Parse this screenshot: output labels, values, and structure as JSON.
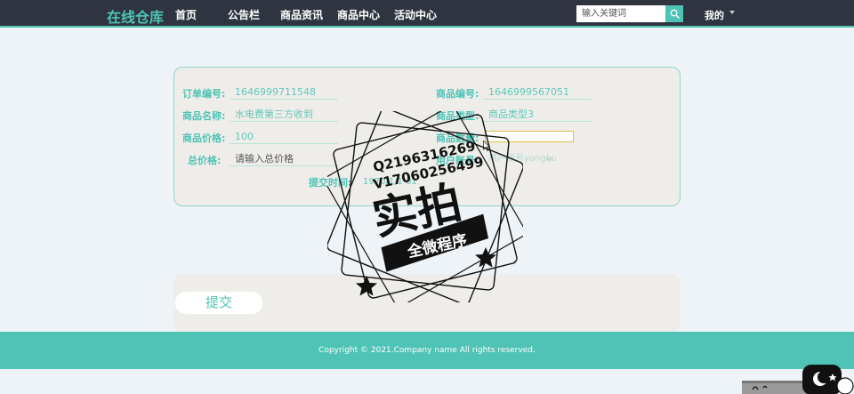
{
  "nav": {
    "brand": "在线仓库",
    "items": [
      "首页",
      "公告栏",
      "商品资讯",
      "商品中心",
      "活动中心"
    ],
    "search_placeholder": "输入关键词",
    "user_menu": "我的"
  },
  "form": {
    "order_no_label": "订单编号:",
    "order_no_value": "1646999711548",
    "product_no_label": "商品编号:",
    "product_no_value": "1646999567051",
    "product_name_label": "商品名称:",
    "product_name_value": "水电费第三方收到",
    "product_type_label": "商品类型:",
    "product_type_value": "商品类型3",
    "price_label": "商品价格:",
    "price_value": "100",
    "quantity_label": "商品数量:",
    "total_label": "总价格:",
    "total_placeholder": "请输入总价格",
    "user_account_label": "用户账号:",
    "user_account_value": "用户账号yonghu",
    "submit_time_label": "提交时间:",
    "submit_time_value": "1970/1/1 01"
  },
  "actions": {
    "submit_label": "提交"
  },
  "footer": {
    "copyright": "Copyright © 2021.Company name All rights reserved."
  },
  "watermark": {
    "line1": "Q2196316269",
    "line2": "V17060256499",
    "big": "实拍",
    "ribbon": "全微程序"
  },
  "colors": {
    "accent": "#4fc3b5",
    "navbar": "#2e3440",
    "panel": "#efedea",
    "page_bg": "#eef3f7"
  },
  "icons": [
    "search-icon",
    "chevron-down-icon",
    "mouse-cursor-icon",
    "star-icon",
    "mascot-icon"
  ]
}
